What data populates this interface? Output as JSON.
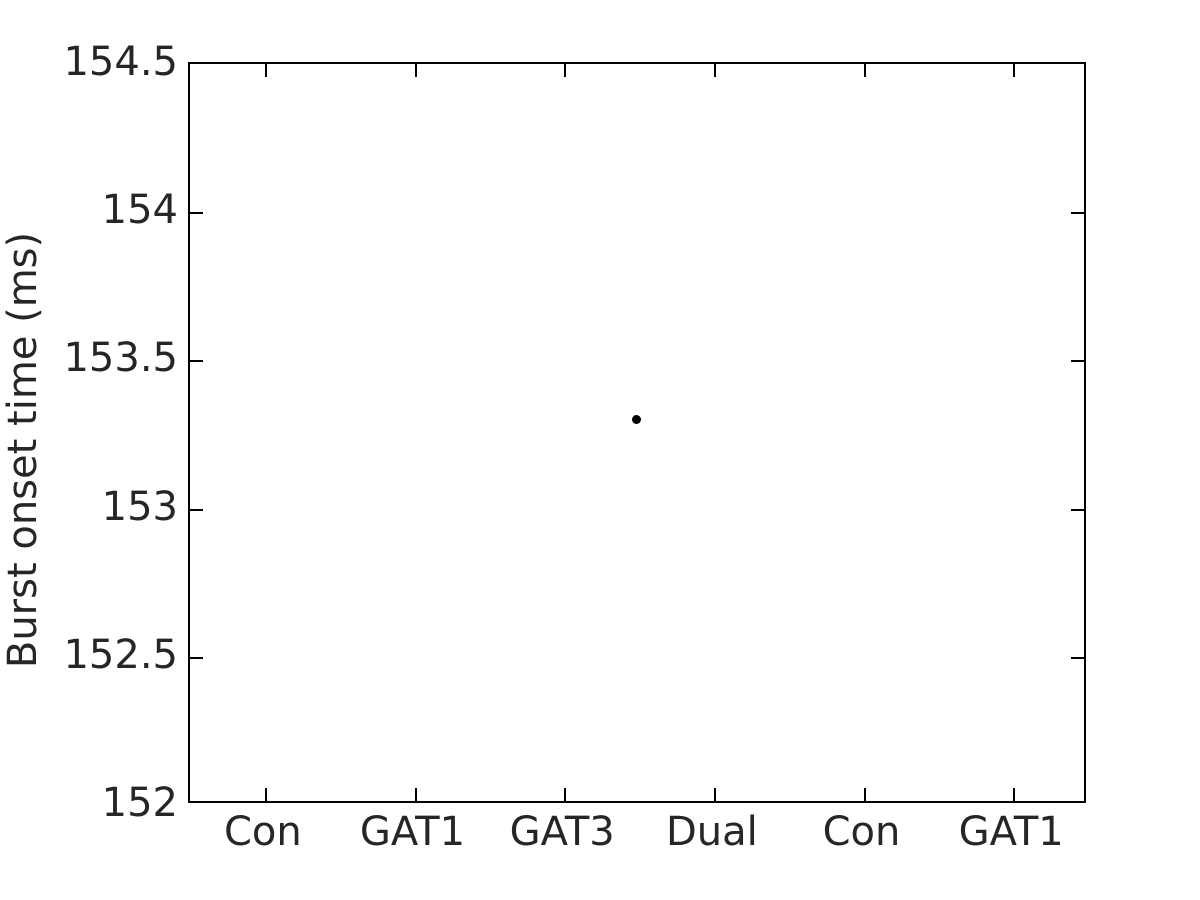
{
  "figure": {
    "background_color": "#ffffff",
    "axis_color": "#000000",
    "text_color": "#262626",
    "marker_color": "#000000"
  },
  "axes": {
    "ylabel": "Burst onset time (ms)",
    "xlabel": "",
    "title": ""
  },
  "yticks": [
    {
      "value": 152,
      "label": "152"
    },
    {
      "value": 152.5,
      "label": "152.5"
    },
    {
      "value": 153,
      "label": "153"
    },
    {
      "value": 153.5,
      "label": "153.5"
    },
    {
      "value": 154,
      "label": "154"
    },
    {
      "value": 154.5,
      "label": "154.5"
    }
  ],
  "xticks": [
    {
      "value": 0,
      "label": "Con"
    },
    {
      "value": 1,
      "label": "GAT1"
    },
    {
      "value": 2,
      "label": "GAT3"
    },
    {
      "value": 3,
      "label": "Dual"
    },
    {
      "value": 4,
      "label": "Con"
    },
    {
      "value": 5,
      "label": "GAT1"
    }
  ],
  "chart_data": {
    "type": "scatter",
    "title": "",
    "xlabel": "",
    "ylabel": "Burst onset time (ms)",
    "categories": [
      "Con",
      "GAT1",
      "GAT3",
      "Dual",
      "Con",
      "GAT1"
    ],
    "xlim": [
      -0.5,
      5.5
    ],
    "ylim": [
      152,
      154.5
    ],
    "ytick_values": [
      152,
      152.5,
      153,
      153.5,
      154,
      154.5
    ],
    "xtick_values": [
      0,
      1,
      2,
      3,
      4,
      5
    ],
    "grid": false,
    "legend": null,
    "series": [
      {
        "name": "Burst onset time",
        "marker": "circle",
        "marker_color": "#000000",
        "marker_size": 9,
        "points": [
          {
            "x": 2.48,
            "y": 153.3,
            "category": "GAT3"
          }
        ]
      }
    ],
    "notes": "Single visible black filled circle marker; all other category positions are empty."
  }
}
